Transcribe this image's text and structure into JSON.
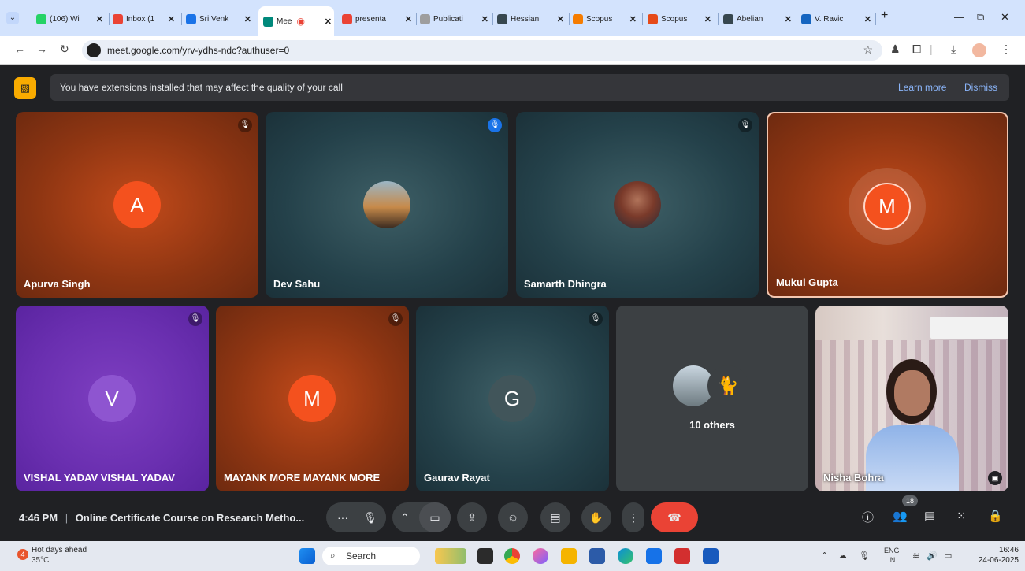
{
  "browser": {
    "tabs": [
      {
        "label": "(106) Wi",
        "color": "#25d366"
      },
      {
        "label": "Inbox (1",
        "color": "#ea4335"
      },
      {
        "label": "Sri Venk",
        "color": "#1a73e8"
      },
      {
        "label": "Mee",
        "color": "#00897b",
        "active": true
      },
      {
        "label": "presenta",
        "color": "#ea4335"
      },
      {
        "label": "Publicati",
        "color": "#9e9e9e"
      },
      {
        "label": "Hessian",
        "color": "#37474f"
      },
      {
        "label": "Scopus",
        "color": "#f57c00"
      },
      {
        "label": "Scopus",
        "color": "#e64a19"
      },
      {
        "label": "Abelian",
        "color": "#37474f"
      },
      {
        "label": "V. Ravic",
        "color": "#1565c0"
      }
    ],
    "new_tab": "+",
    "url": "meet.google.com/yrv-ydhs-ndc?authuser=0"
  },
  "notice": {
    "message": "You have extensions installed that may affect the quality of your call",
    "learn_more": "Learn more",
    "dismiss": "Dismiss"
  },
  "participants": [
    {
      "name": "Apurva Singh",
      "initial": "A",
      "bg": "orange",
      "avatar_color": "#f4511e",
      "muted": true
    },
    {
      "name": "Dev Sahu",
      "initial": "",
      "bg": "teal",
      "avatar_color": "#7a8f99",
      "muted": true
    },
    {
      "name": "Samarth Dhingra",
      "initial": "",
      "bg": "teal",
      "avatar_color": "#6f5a4a",
      "muted": true
    },
    {
      "name": "Mukul Gupta",
      "initial": "M",
      "bg": "orange",
      "avatar_color": "#f4511e",
      "muted": false
    },
    {
      "name": "VISHAL YADAV VISHAL YADAV",
      "initial": "V",
      "bg": "purple",
      "avatar_color": "#8e55d0",
      "muted": true
    },
    {
      "name": "MAYANK MORE MAYANK MORE",
      "initial": "M",
      "bg": "orange",
      "avatar_color": "#f4511e",
      "muted": true
    },
    {
      "name": "Gaurav Rayat",
      "initial": "G",
      "bg": "teal",
      "avatar_color": "#41555a",
      "muted": true
    },
    {
      "name": "10 others",
      "initial": "",
      "bg": "grey"
    },
    {
      "name": "Nisha Bohra",
      "initial": "",
      "bg": "video"
    }
  ],
  "meeting": {
    "time": "4:46 PM",
    "separator": "|",
    "title": "Online Certificate Course on Research Metho...",
    "people_count": "18"
  },
  "taskbar": {
    "weather_title": "Hot days ahead",
    "weather_temp": "35°C",
    "weather_badge": "4",
    "search": "Search",
    "lang_top": "ENG",
    "lang_bottom": "IN",
    "time": "16:46",
    "date": "24-06-2025"
  },
  "icons": {
    "mic_off": "mic-off-icon",
    "camera": "camera-icon",
    "present": "present-icon",
    "emoji": "emoji-icon",
    "captions": "captions-icon",
    "hand": "raise-hand-icon",
    "more": "more-icon",
    "end_call": "end-call-icon"
  }
}
